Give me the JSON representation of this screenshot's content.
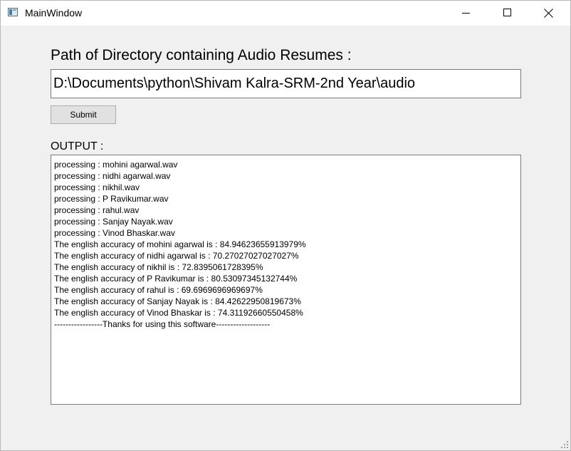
{
  "window": {
    "title": "MainWindow",
    "icon": "app-window-icon"
  },
  "form": {
    "path_label": "Path of Directory containing Audio Resumes :",
    "path_value": "D:\\Documents\\python\\Shivam Kalra-SRM-2nd Year\\audio",
    "submit_label": "Submit",
    "output_label": "OUTPUT :"
  },
  "output": {
    "lines": [
      "processing : mohini agarwal.wav",
      "processing : nidhi agarwal.wav",
      "processing : nikhil.wav",
      "processing : P Ravikumar.wav",
      "processing : rahul.wav",
      "processing : Sanjay Nayak.wav",
      "processing : Vinod Bhaskar.wav",
      "The english accuracy of mohini agarwal is : 84.94623655913979%",
      "The english accuracy of nidhi agarwal is : 70.27027027027027%",
      "The english accuracy of nikhil is : 72.8395061728395%",
      "The english accuracy of P Ravikumar is : 80.53097345132744%",
      "The english accuracy of rahul is : 69.6969696969697%",
      "The english accuracy of Sanjay Nayak is : 84.42622950819673%",
      "The english accuracy of Vinod Bhaskar is : 74.31192660550458%",
      "-----------------Thanks for using this software-------------------"
    ]
  },
  "colors": {
    "window_bg": "#f0f0f0",
    "titlebar_bg": "#ffffff",
    "button_bg": "#e1e1e1",
    "border": "#7a7a7a"
  }
}
